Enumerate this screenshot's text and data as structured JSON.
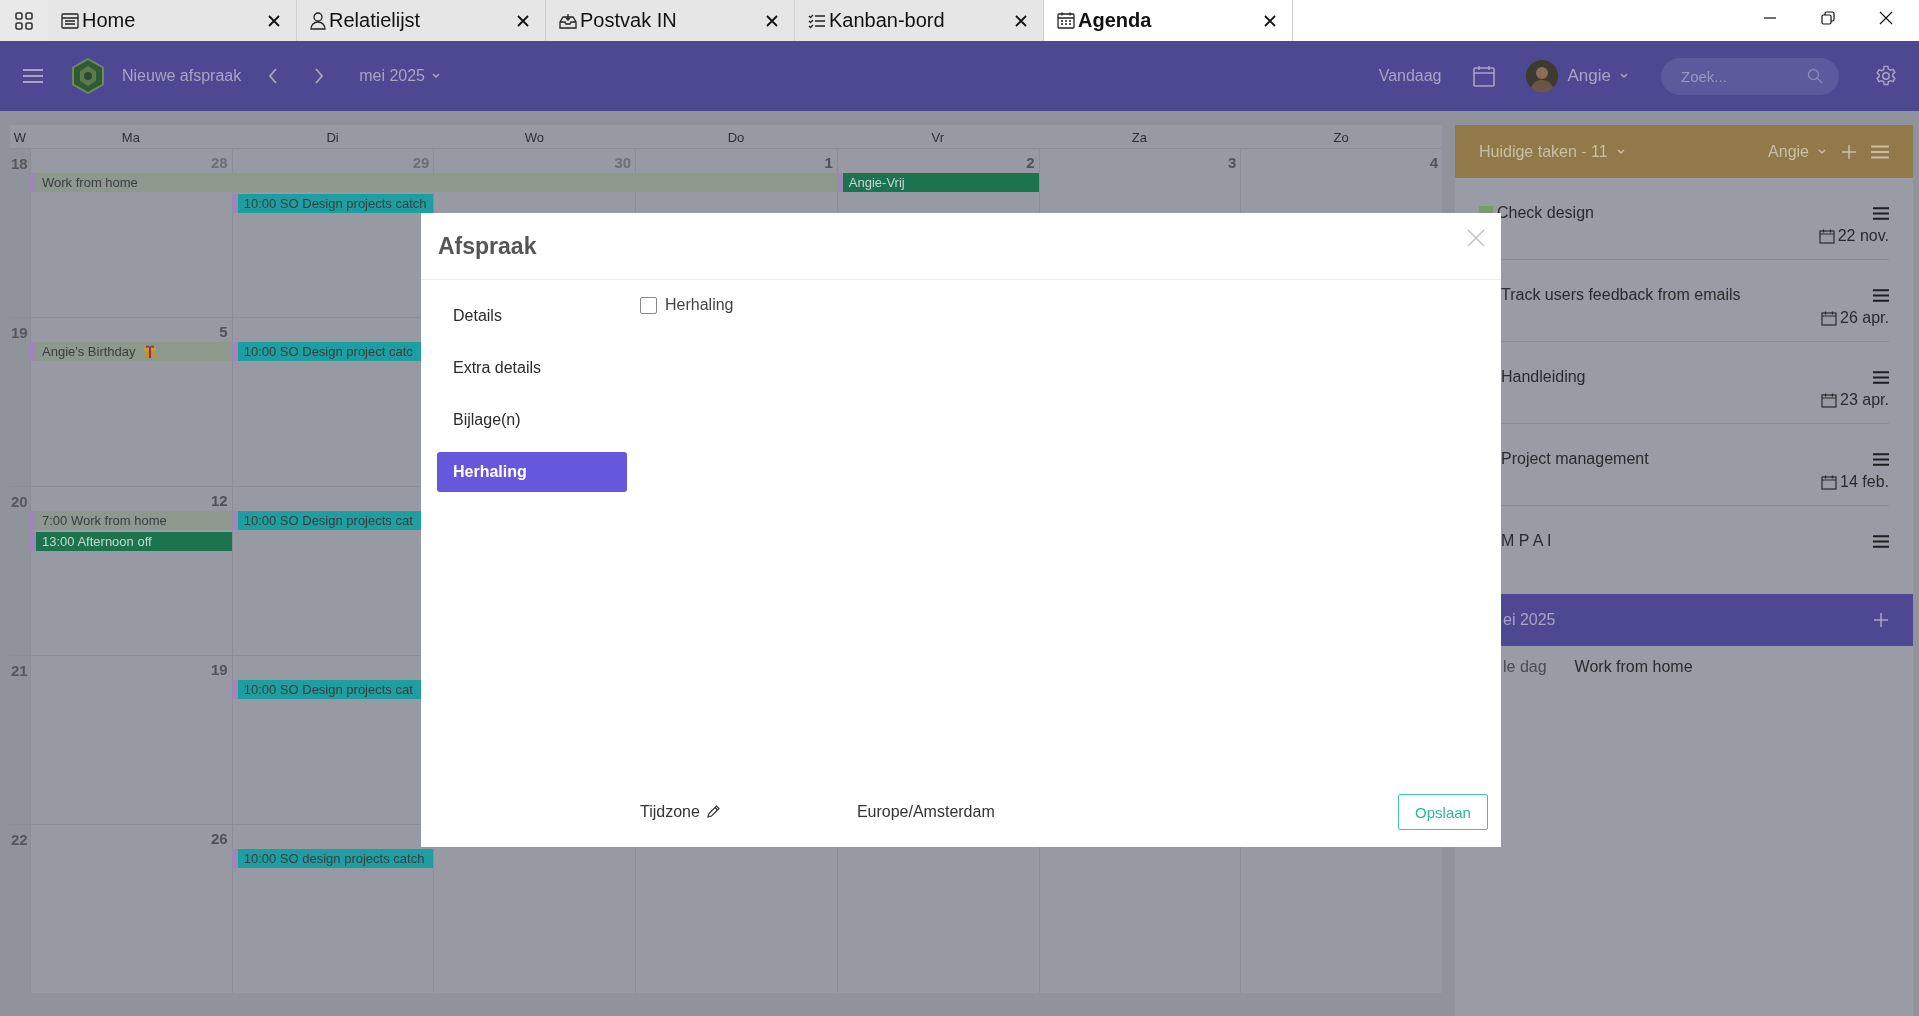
{
  "tabs": [
    {
      "label": "Home",
      "selected": false
    },
    {
      "label": "Relatielijst",
      "selected": false
    },
    {
      "label": "Postvak IN",
      "selected": false
    },
    {
      "label": "Kanban-bord",
      "selected": false
    },
    {
      "label": "Agenda",
      "selected": true
    }
  ],
  "toolbar": {
    "new_appointment": "Nieuwe afspraak",
    "month": "mei 2025",
    "today": "Vandaag",
    "user": "Angie",
    "search": {
      "placeholder": "Zoek..."
    }
  },
  "calendar": {
    "week_header": "W",
    "days": [
      "Ma",
      "Di",
      "Wo",
      "Do",
      "Vr",
      "Za",
      "Zo"
    ],
    "weeks": [
      {
        "number": "18",
        "cells": [
          {
            "date": "28",
            "other_month": true,
            "events": [
              {
                "kind": "start",
                "text": "Work from home",
                "color": "#8e998d"
              }
            ]
          },
          {
            "date": "29",
            "other_month": true,
            "events": [
              {
                "kind": "continued",
                "color": "#8e998d"
              },
              {
                "kind": "start",
                "text": "10:00 SO Design projects catch",
                "color": "#1f9ea1"
              }
            ]
          },
          {
            "date": "30",
            "other_month": true,
            "events": [
              {
                "kind": "continued",
                "color": "#8e998d"
              }
            ]
          },
          {
            "date": "1",
            "other_month": false,
            "events": [
              {
                "kind": "continued",
                "color": "#8e998d"
              }
            ]
          },
          {
            "date": "2",
            "other_month": false,
            "events": [
              {
                "kind": "start",
                "text": "Angie-Vrij",
                "color": "#1b744e"
              }
            ]
          },
          {
            "date": "3",
            "other_month": false
          },
          {
            "date": "4",
            "other_month": false
          }
        ]
      },
      {
        "number": "19",
        "cells": [
          {
            "date": "5",
            "other_month": false,
            "events": [
              {
                "kind": "birthday",
                "text": "Angie's Birthday",
                "color": "#8e998d"
              }
            ]
          },
          {
            "events": [
              {
                "kind": "start",
                "text": "10:00 SO Design project catc",
                "color": "#1f9ea1"
              }
            ]
          },
          {},
          {},
          {},
          {},
          {}
        ]
      },
      {
        "number": "20",
        "cells": [
          {
            "date": "12",
            "other_month": false,
            "events": [
              {
                "kind": "start",
                "text": "7:00 Work from home",
                "color": "#8e998d"
              },
              {
                "kind": "start",
                "text": "13:00 Afternoon off",
                "color": "#1b744e"
              }
            ]
          },
          {
            "events": [
              {
                "kind": "start",
                "text": "10:00 SO Design projects cat",
                "color": "#1f9ea1"
              }
            ]
          },
          {},
          {},
          {},
          {},
          {}
        ]
      },
      {
        "number": "21",
        "cells": [
          {
            "date": "19",
            "other_month": false
          },
          {
            "events": [
              {
                "kind": "start",
                "text": "10:00 SO Design projects cat",
                "color": "#1f9ea1"
              }
            ]
          },
          {},
          {},
          {},
          {},
          {}
        ]
      },
      {
        "number": "22",
        "cells": [
          {
            "date": "26",
            "other_month": false
          },
          {
            "events": [
              {
                "kind": "start",
                "text": "10:00 SO design projects catch",
                "color": "#1f9ea1"
              }
            ]
          },
          {},
          {},
          {},
          {},
          {}
        ]
      }
    ]
  },
  "tasks": {
    "title": "Huidige taken - 11",
    "user": "Angie",
    "items": [
      {
        "title": "Check design",
        "color": "#7b9a6e",
        "date": "22 nov."
      },
      {
        "title": "Track users feedback from emails",
        "date": "26 apr."
      },
      {
        "title": "Handleiding",
        "date": "23 apr."
      },
      {
        "title": "Project management",
        "date": "14 feb."
      },
      {
        "title": "M P A I"
      }
    ]
  },
  "month_panel": {
    "title": "ei 2025",
    "rows": [
      {
        "label": "le dag",
        "event": "Work from home"
      }
    ]
  },
  "modal": {
    "title": "Afspraak",
    "nav": [
      {
        "label": "Details",
        "selected": false
      },
      {
        "label": "Extra details",
        "selected": false
      },
      {
        "label": "Bijlage(n)",
        "selected": false
      },
      {
        "label": "Herhaling",
        "selected": true
      }
    ],
    "repeat": {
      "label": "Herhaling",
      "checked": false
    },
    "timezone_label": "Tijdzone",
    "timezone": "Europe/Amsterdam",
    "save": "Opslaan"
  }
}
